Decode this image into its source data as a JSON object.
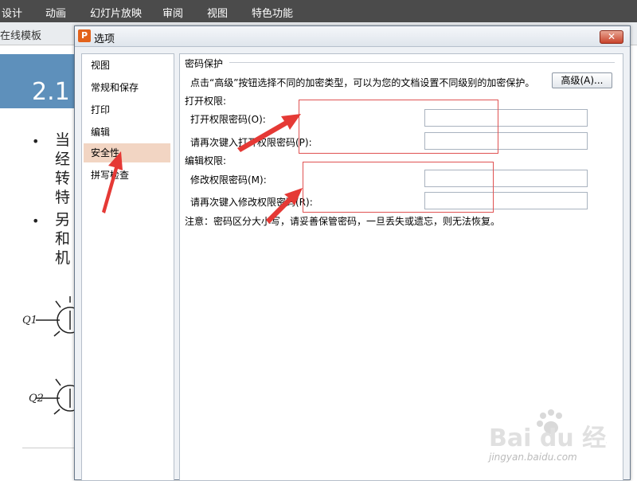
{
  "ribbon": {
    "items": [
      "设计",
      "动画",
      "幻灯片放映",
      "审阅",
      "视图",
      "特色功能"
    ]
  },
  "tabbar": {
    "label": "在线模板"
  },
  "slide": {
    "title": "2.1",
    "bullet1_lines": [
      "当",
      "经",
      "转",
      "特"
    ],
    "bullet2_lines": [
      "另",
      "和",
      "机"
    ],
    "q1": "Q1",
    "q2": "Q2"
  },
  "dialog": {
    "title": "选项",
    "close_label": "✕",
    "sidebar": [
      "视图",
      "常规和保存",
      "打印",
      "编辑",
      "安全性",
      "拼写检查"
    ],
    "active_index": 4,
    "section_title": "密码保护",
    "description": "点击“高级”按钮选择不同的加密类型，可以为您的文档设置不同级别的加密保护。",
    "advanced_button": "高级(A)...",
    "open_permission": {
      "heading": "打开权限:",
      "password_label": "打开权限密码(O):",
      "confirm_label": "请再次键入打开权限密码(P):",
      "password_value": "",
      "confirm_value": ""
    },
    "edit_permission": {
      "heading": "编辑权限:",
      "password_label": "修改权限密码(M):",
      "confirm_label": "请再次键入修改权限密码(R):",
      "password_value": "",
      "confirm_value": ""
    },
    "note": "注意：密码区分大小写，请妥善保管密码，一旦丢失或遗忘，则无法恢复。"
  },
  "watermark": {
    "logo": "Bai du 经验",
    "url": "jingyan.baidu.com"
  },
  "colors": {
    "accent_active": "#f2d5c3",
    "highlight_red": "#e05252",
    "ribbon_bg": "#4b4b4b"
  }
}
